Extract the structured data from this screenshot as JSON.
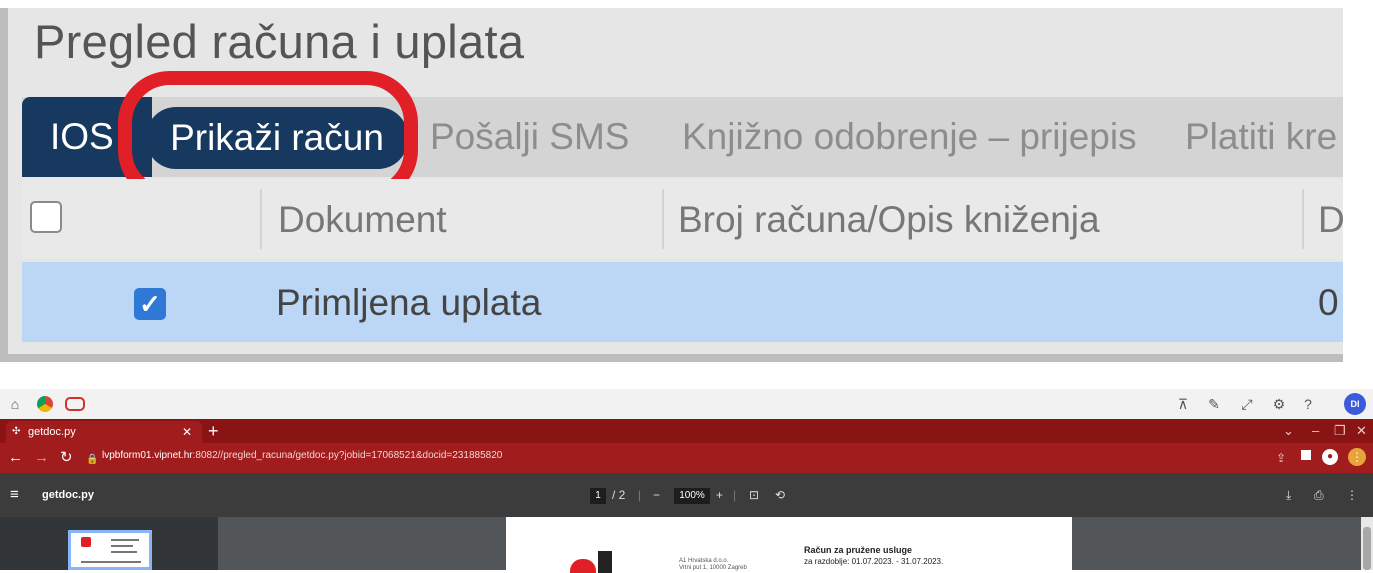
{
  "zoom": {
    "title": "Pregled računa i uplata",
    "tabs": [
      "IOS",
      "Prikaži račun",
      "Pošalji SMS",
      "Knjižno odobrenje – prijepis",
      "Platiti kre"
    ],
    "columns": [
      "Dokument",
      "Broj računa/Opis kniženja",
      "D"
    ],
    "row": {
      "dokument": "Primljena uplata",
      "trailing": "0",
      "checked": true
    }
  },
  "colors": {
    "highlight": "#e11f26",
    "tab_active": "#17395f",
    "row_selected": "#bcd6f5",
    "browser_frame": "#a11c1c"
  },
  "browser": {
    "os_icons": [
      "home-icon",
      "chrome-icon",
      "remote-icon"
    ],
    "os_right_icons": [
      "pin-icon",
      "magic-icon",
      "expand-icon",
      "settings-icon",
      "help-icon"
    ],
    "avatar": "DI",
    "tab_title": "getdoc.py",
    "url_host": "lvpbform01.vipnet.hr",
    "url_path": ":8082//pregled_racuna/getdoc.py?jobid=17068521&docid=231885820",
    "pdf": {
      "title": "getdoc.py",
      "page_current": "1",
      "page_total": "/ 2",
      "zoom": "100%",
      "company_line1": "A1 Hrvatska d.o.o.",
      "company_line2": "Vrtni put 1, 10000 Zagreb",
      "invoice_title": "Račun za pružene usluge",
      "invoice_period": "za razdoblje: 01.07.2023. - 31.07.2023."
    }
  }
}
